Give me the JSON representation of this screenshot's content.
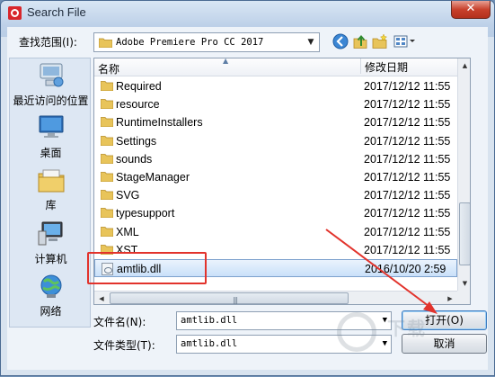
{
  "window": {
    "title": "Search File",
    "close_label": "✕"
  },
  "toolbar": {
    "lookin_label": "查找范围(I):",
    "lookin_value": "Adobe Premiere Pro CC 2017",
    "back_icon": "back-arrow-icon",
    "up_icon": "up-folder-icon",
    "new_folder_icon": "new-folder-icon",
    "views_icon": "views-menu-icon"
  },
  "places": [
    {
      "label": "最近访问的位置",
      "icon": "recent-places-icon"
    },
    {
      "label": "桌面",
      "icon": "desktop-icon"
    },
    {
      "label": "库",
      "icon": "libraries-icon"
    },
    {
      "label": "计算机",
      "icon": "computer-icon"
    },
    {
      "label": "网络",
      "icon": "network-icon"
    }
  ],
  "list": {
    "col_name": "名称",
    "col_date": "修改日期",
    "rows": [
      {
        "name": "Required",
        "date": "2017/12/12 11:55",
        "kind": "folder"
      },
      {
        "name": "resource",
        "date": "2017/12/12 11:55",
        "kind": "folder"
      },
      {
        "name": "RuntimeInstallers",
        "date": "2017/12/12 11:55",
        "kind": "folder"
      },
      {
        "name": "Settings",
        "date": "2017/12/12 11:55",
        "kind": "folder"
      },
      {
        "name": "sounds",
        "date": "2017/12/12 11:55",
        "kind": "folder"
      },
      {
        "name": "StageManager",
        "date": "2017/12/12 11:55",
        "kind": "folder"
      },
      {
        "name": "SVG",
        "date": "2017/12/12 11:55",
        "kind": "folder"
      },
      {
        "name": "typesupport",
        "date": "2017/12/12 11:55",
        "kind": "folder"
      },
      {
        "name": "XML",
        "date": "2017/12/12 11:55",
        "kind": "folder"
      },
      {
        "name": "XST",
        "date": "2017/12/12 11:55",
        "kind": "folder"
      },
      {
        "name": "amtlib.dll",
        "date": "2016/10/20 2:59",
        "kind": "file",
        "selected": true
      }
    ]
  },
  "form": {
    "filename_label": "文件名(N):",
    "filename_value": "amtlib.dll",
    "filetype_label": "文件类型(T):",
    "filetype_value": "amtlib.dll",
    "open_label": "打开(O)",
    "cancel_label": "取消"
  },
  "colors": {
    "annotation_red": "#e2332c"
  }
}
